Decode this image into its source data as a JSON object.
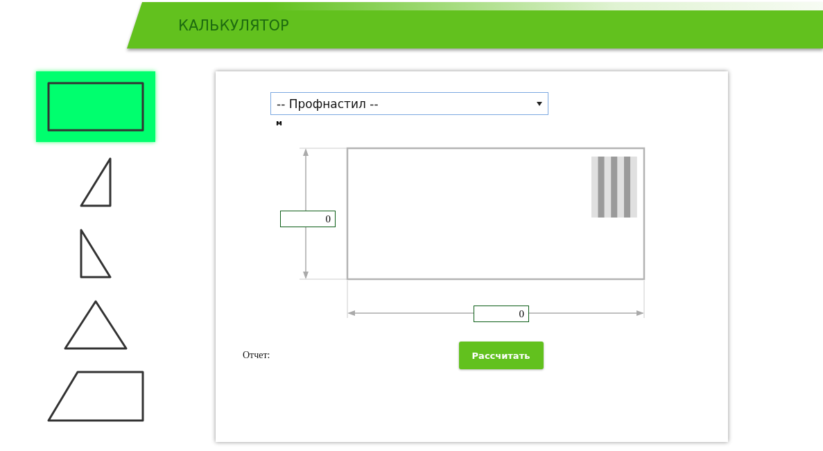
{
  "header": {
    "title": "КАЛЬКУЛЯТОР"
  },
  "shapes": [
    {
      "kind": "rectangle",
      "selected": true
    },
    {
      "kind": "right-triangle-left",
      "selected": false
    },
    {
      "kind": "right-triangle-right",
      "selected": false
    },
    {
      "kind": "triangle",
      "selected": false
    },
    {
      "kind": "trapezoid",
      "selected": false
    }
  ],
  "material_select": {
    "value": "-- Профнастил --",
    "unit": "м"
  },
  "diagram": {
    "height_field": {
      "value": "0"
    },
    "width_field": {
      "value": "0"
    }
  },
  "report_label": "Отчет:",
  "calculate_button": "Рассчитать"
}
